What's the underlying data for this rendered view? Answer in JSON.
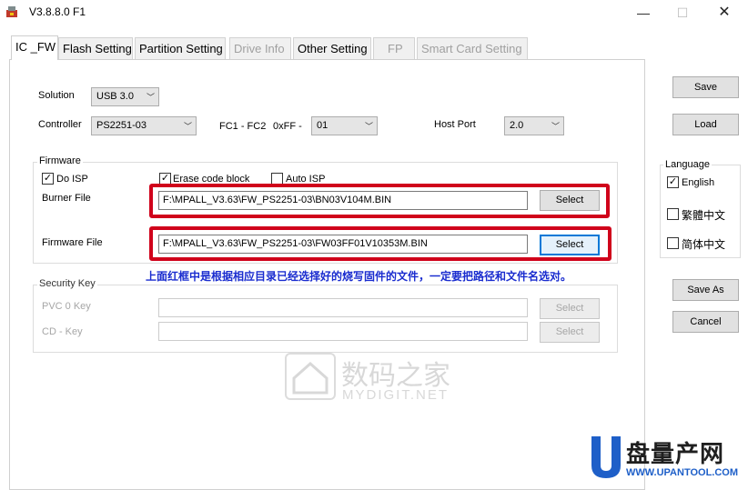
{
  "window": {
    "title": "V3.8.8.0 F1",
    "min_label": "—",
    "max_label": "☐",
    "close_label": "✕"
  },
  "tabs": [
    {
      "label": "IC _FW",
      "active": true,
      "enabled": true
    },
    {
      "label": "Flash Setting",
      "enabled": true
    },
    {
      "label": "Partition Setting",
      "enabled": true
    },
    {
      "label": "Drive Info",
      "enabled": false
    },
    {
      "label": "Other Setting",
      "enabled": true
    },
    {
      "label": "FP",
      "enabled": false
    },
    {
      "label": "Smart Card Setting",
      "enabled": false
    }
  ],
  "settings": {
    "solution_label": "Solution",
    "solution_value": "USB 3.0",
    "controller_label": "Controller",
    "controller_value": "PS2251-03",
    "fc_label": "FC1 - FC2",
    "fc_prefix": "0xFF -",
    "fc_value": "01",
    "hostport_label": "Host Port",
    "hostport_value": "2.0"
  },
  "firmware": {
    "group_title": "Firmware",
    "do_isp_label": "Do ISP",
    "do_isp_checked": true,
    "erase_label": "Erase code block",
    "erase_checked": true,
    "auto_isp_label": "Auto ISP",
    "auto_isp_checked": false,
    "burner_label": "Burner File",
    "burner_path": "F:\\MPALL_V3.63\\FW_PS2251-03\\BN03V104M.BIN",
    "firmware_label": "Firmware File",
    "firmware_path": "F:\\MPALL_V3.63\\FW_PS2251-03\\FW03FF01V10353M.BIN",
    "select_label": "Select"
  },
  "annotation": "上面红框中是根据相应目录已经选择好的烧写固件的文件，一定要把路径和文件名选对。",
  "security": {
    "group_title": "Security Key",
    "pvc_label": "PVC 0 Key",
    "cd_label": "CD - Key",
    "pvc_value": "",
    "cd_value": "",
    "select_label": "Select"
  },
  "side": {
    "save_label": "Save",
    "load_label": "Load",
    "language_title": "Language",
    "english_label": "English",
    "english_checked": true,
    "trad_label": "繁體中文",
    "trad_checked": false,
    "simp_label": "简体中文",
    "simp_checked": false,
    "save_as_label": "Save As",
    "cancel_label": "Cancel"
  },
  "watermarks": {
    "center_cn": "数码之家",
    "center_en": "MYDIGIT.NET",
    "corner_cn": "盘量产网",
    "corner_en": "WWW.UPANTOOL.COM"
  },
  "colors": {
    "accent": "#0078d7",
    "highlight_box": "#d0021b",
    "annotation": "#1a2ccf"
  }
}
